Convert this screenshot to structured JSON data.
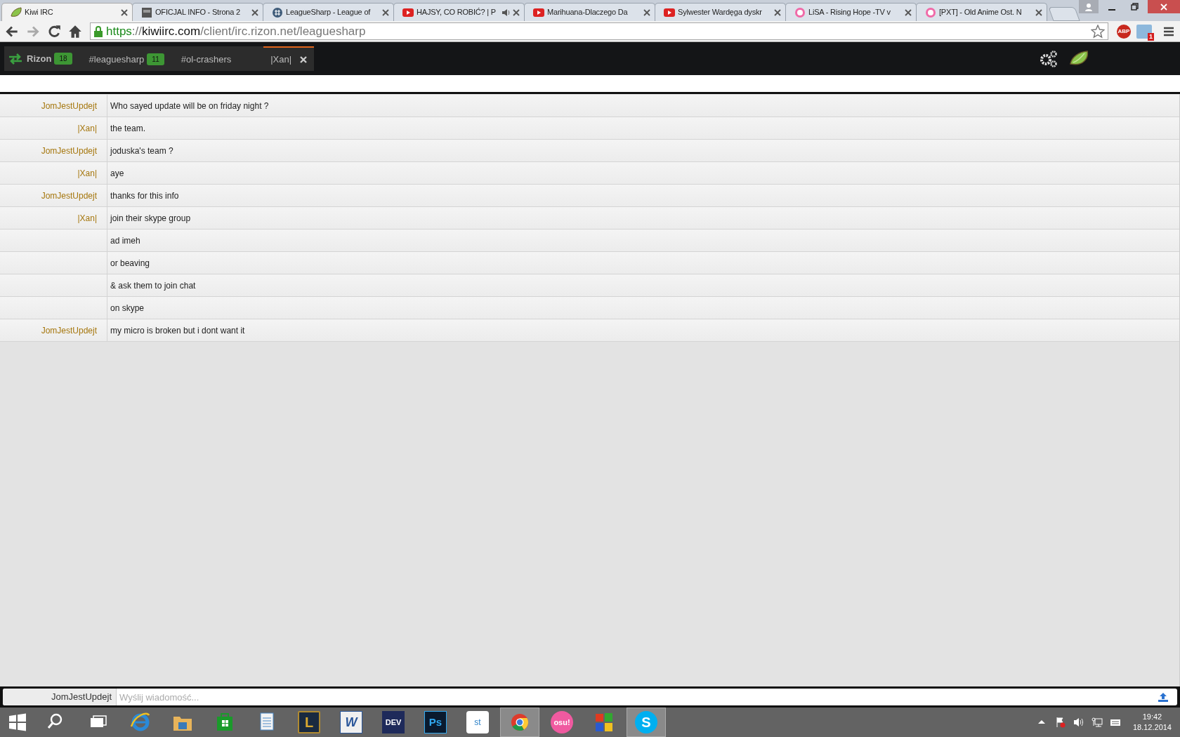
{
  "browser": {
    "tabs": [
      {
        "title": "Kiwi IRC",
        "kind": "kiwi",
        "selected": true
      },
      {
        "title": "OFICJAL INFO - Strona 2",
        "kind": "mpc",
        "selected": false
      },
      {
        "title": "LeagueSharp - League of",
        "kind": "hash",
        "selected": false
      },
      {
        "title": "HAJSY, CO ROBIĆ? | P",
        "kind": "youtube",
        "audio": true,
        "selected": false
      },
      {
        "title": "Marihuana-Dlaczego Da",
        "kind": "youtube",
        "selected": false
      },
      {
        "title": "Sylwester Wardęga dyskr",
        "kind": "youtube",
        "selected": false
      },
      {
        "title": "LiSA - Rising Hope -TV v",
        "kind": "osu",
        "selected": false
      },
      {
        "title": "[PXT] - Old Anime Ost. N",
        "kind": "osu",
        "selected": false
      }
    ],
    "url": {
      "scheme": "https",
      "separator": "://",
      "host": "kiwiirc.com",
      "path": "/client/irc.rizon.net/leaguesharp"
    },
    "extensions": [
      {
        "label": "ABP",
        "kind": "abp"
      },
      {
        "label": "1",
        "kind": "tv"
      }
    ]
  },
  "kiwi": {
    "server": {
      "name": "Rizon",
      "count": "18"
    },
    "channels": [
      {
        "name": "#leaguesharp",
        "count": "11",
        "selected": false,
        "closable": false
      },
      {
        "name": "#ol-crashers",
        "selected": false,
        "closable": false
      },
      {
        "name": "|Xan|",
        "selected": true,
        "closable": true
      }
    ],
    "messages": [
      {
        "nick": "JomJestUpdejt",
        "text": "Who sayed update will be on friday night ?"
      },
      {
        "nick": "|Xan|",
        "text": "the team."
      },
      {
        "nick": "JomJestUpdejt",
        "text": "joduska's team ?"
      },
      {
        "nick": "|Xan|",
        "text": "aye"
      },
      {
        "nick": "JomJestUpdejt",
        "text": "thanks for this info"
      },
      {
        "nick": "|Xan|",
        "text": "join their skype group"
      },
      {
        "text": "ad imeh"
      },
      {
        "text": "or beaving"
      },
      {
        "text": "& ask them to join chat"
      },
      {
        "text": "on skype"
      },
      {
        "nick": "JomJestUpdejt",
        "text": "my micro is broken but i dont want it"
      }
    ],
    "input": {
      "nick": "JomJestUpdejt",
      "placeholder": "Wyślij wiadomość..."
    }
  },
  "taskbar": {
    "apps": [
      {
        "kind": "search",
        "selected": false
      },
      {
        "kind": "taskview",
        "selected": false
      },
      {
        "kind": "ie",
        "selected": false
      },
      {
        "kind": "explorer",
        "selected": false
      },
      {
        "kind": "store",
        "selected": false
      },
      {
        "kind": "doc",
        "selected": false
      },
      {
        "kind": "league",
        "label": "L",
        "selected": false
      },
      {
        "kind": "word",
        "label": "W",
        "selected": false
      },
      {
        "kind": "dev",
        "label": "DEV",
        "selected": false
      },
      {
        "kind": "ps",
        "label": "Ps",
        "selected": false
      },
      {
        "kind": "st",
        "label": "st",
        "selected": false
      },
      {
        "kind": "chrome",
        "selected": true
      },
      {
        "kind": "osu",
        "label": "osu!",
        "selected": false
      },
      {
        "kind": "winxp",
        "selected": false
      },
      {
        "kind": "skype",
        "label": "S",
        "selected": true
      }
    ],
    "clock": {
      "time": "19:42",
      "date": "18.12.2014"
    }
  }
}
